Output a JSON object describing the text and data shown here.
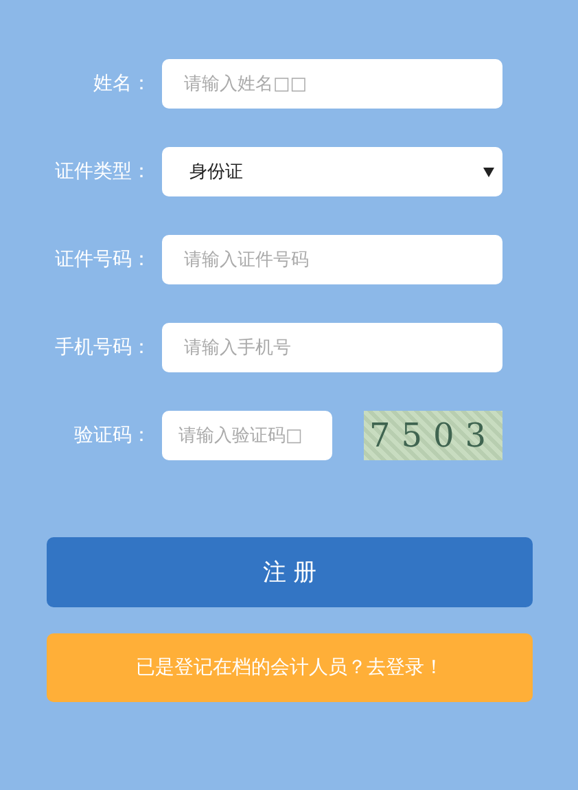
{
  "fields": [
    {
      "kind": "text",
      "label": "姓名：",
      "placeholder": "请输入姓名□□"
    },
    {
      "kind": "select",
      "label": "证件类型：",
      "value": "身份证"
    },
    {
      "kind": "text",
      "label": "证件号码：",
      "placeholder": "请输入证件号码"
    },
    {
      "kind": "text",
      "label": "手机号码：",
      "placeholder": "请输入手机号"
    },
    {
      "kind": "captcha",
      "label": "验证码：",
      "placeholder": "请输入验证码□",
      "captcha": "7503"
    }
  ],
  "register_button": "注 册",
  "login_button": "已是登记在档的会计人员？去登录！"
}
